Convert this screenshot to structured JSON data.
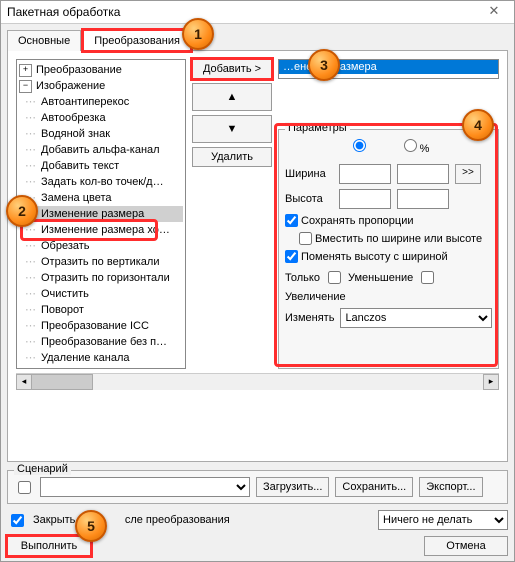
{
  "window": {
    "title": "Пакетная обработка",
    "close": "✕"
  },
  "tabs": {
    "main": "Основные",
    "transform": "Преобразования"
  },
  "tree": {
    "root1": "Преобразование",
    "root2": "Изображение",
    "items": [
      "Автоантиперекос",
      "Автообрезка",
      "Водяной знак",
      "Добавить альфа-канал",
      "Добавить текст",
      "Задать кол-во точек/д…",
      "Замена цвета",
      "Изменение размера",
      "Изменение размера хо…",
      "Обрезать",
      "Отразить по вертикали",
      "Отразить по горизонтали",
      "Очистить",
      "Поворот",
      "Преобразование ICC",
      "Преобразование без п…",
      "Удаление канала"
    ],
    "selected_index": 7
  },
  "buttons": {
    "add": "Добавить >",
    "up": "▲",
    "down": "▼",
    "delete": "Удалить"
  },
  "list": {
    "item": "…енение размера"
  },
  "params": {
    "legend": "Параметры",
    "unit_px": "◉",
    "unit_pct_label": "%",
    "width_label": "Ширина",
    "height_label": "Высота",
    "more": ">>",
    "keep_ratio": "Сохранять пропорции",
    "fit_wh": "Вместить по ширине или высоте",
    "swap": "Поменять высоту с шириной",
    "only_label": "Только",
    "decrease": "Уменьшение",
    "increase": "Увеличение",
    "resize_label": "Изменять",
    "method": "Lanczos"
  },
  "scenario": {
    "legend": "Сценарий",
    "load": "Загрузить...",
    "save": "Сохранить...",
    "export": "Экспорт..."
  },
  "bottom": {
    "close_after": "Закрыть д…        сле преобразования",
    "close_after_left": "Закрыть д",
    "close_after_right": "сле преобразования",
    "after_action": "Ничего не делать",
    "run": "Выполнить",
    "cancel": "Отмена"
  }
}
